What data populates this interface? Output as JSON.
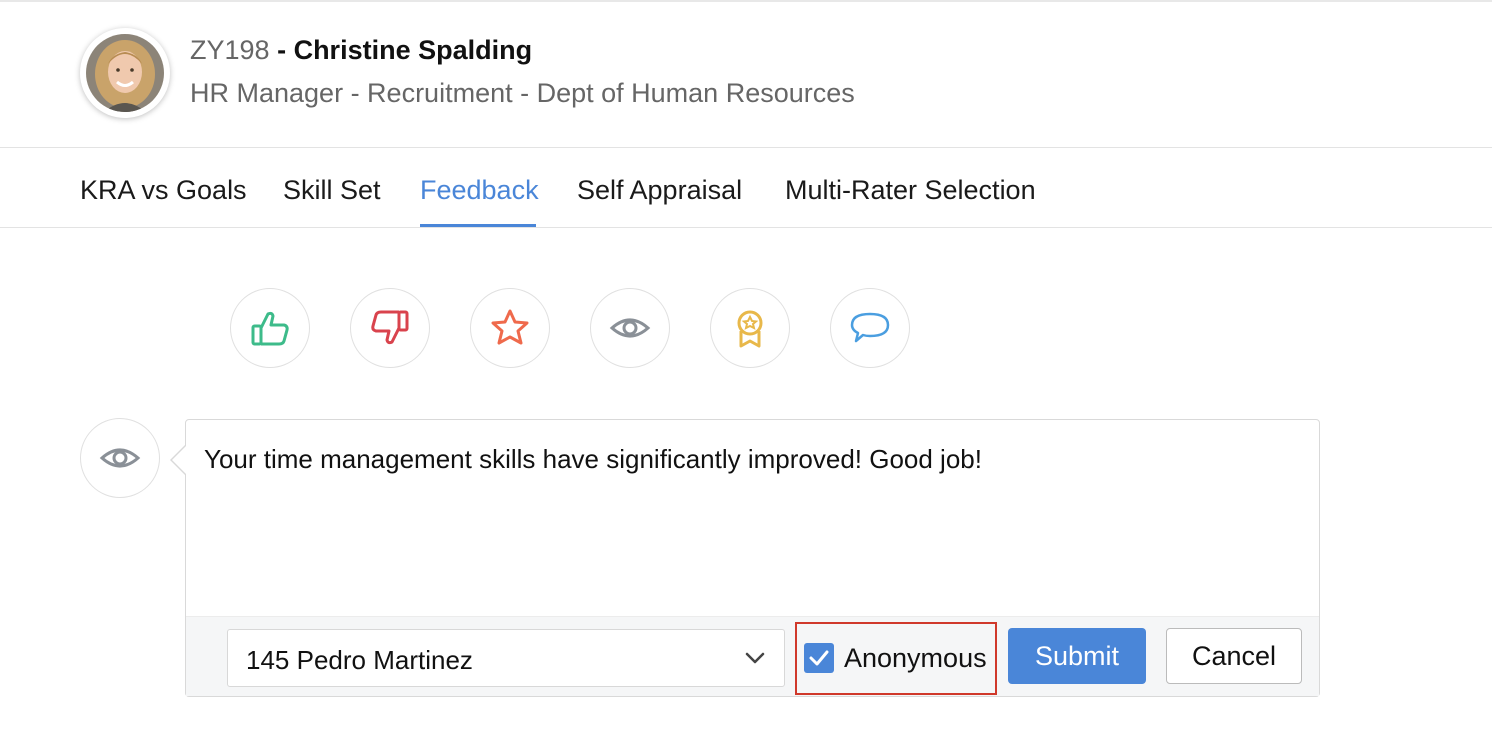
{
  "employee": {
    "id": "ZY198",
    "name": "- Christine Spalding",
    "role": "HR Manager - Recruitment - Dept of Human Resources"
  },
  "tabs": [
    {
      "label": "KRA vs Goals",
      "active": false
    },
    {
      "label": "Skill Set",
      "active": false
    },
    {
      "label": "Feedback",
      "active": true
    },
    {
      "label": "Self Appraisal",
      "active": false
    },
    {
      "label": "Multi-Rater Selection",
      "active": false
    }
  ],
  "feedback_types": [
    {
      "icon": "thumbs-up-icon",
      "color": "#3dbb8a"
    },
    {
      "icon": "thumbs-down-icon",
      "color": "#d9434d"
    },
    {
      "icon": "star-icon",
      "color": "#ef6a4c"
    },
    {
      "icon": "eye-icon",
      "color": "#8a9097"
    },
    {
      "icon": "award-icon",
      "color": "#e8b84a"
    },
    {
      "icon": "comment-icon",
      "color": "#4a9ee0"
    }
  ],
  "selected_type_icon": "eye-icon",
  "feedback": {
    "text": "Your time management skills have significantly improved! Good job!"
  },
  "recipient": {
    "value": "145 Pedro Martinez"
  },
  "anonymous": {
    "label": "Anonymous",
    "checked": true
  },
  "buttons": {
    "submit": "Submit",
    "cancel": "Cancel"
  },
  "colors": {
    "accent": "#4a86d8",
    "highlight_border": "#d0392b"
  }
}
